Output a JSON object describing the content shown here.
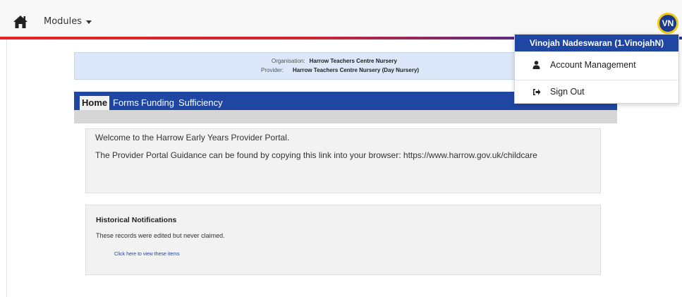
{
  "navbar": {
    "home_icon": "home-icon",
    "modules_label": "Modules",
    "avatar_initials": "VN"
  },
  "organisation": {
    "org_label": "Organisation:",
    "org_value": "Harrow Teachers Centre Nursery",
    "provider_label": "Provider:",
    "provider_value": "Harrow Teachers Centre Nursery (Day Nursery)"
  },
  "tabs": [
    {
      "label": "Home",
      "active": true
    },
    {
      "label": "Forms"
    },
    {
      "label": "Funding"
    },
    {
      "label": "Sufficiency"
    }
  ],
  "welcome": {
    "line1": "Welcome to the Harrow Early Years Provider Portal.",
    "line2": "The Provider Portal Guidance can be found by copying this link into your browser: https://www.harrow.gov.uk/childcare"
  },
  "notifications": {
    "title": "Historical Notifications",
    "description": "These records were edited but never claimed.",
    "link": "Click here to view these items"
  },
  "user_menu": {
    "header": "Vinojah Nadeswaran (1.VinojahN)",
    "items": [
      {
        "label": "Account Management",
        "icon": "user-icon"
      },
      {
        "label": "Sign Out",
        "icon": "sign-out-icon"
      }
    ]
  },
  "colors": {
    "brand_blue": "#1f46a3",
    "accent_red": "#e52324",
    "avatar_ring": "#f2c811"
  }
}
